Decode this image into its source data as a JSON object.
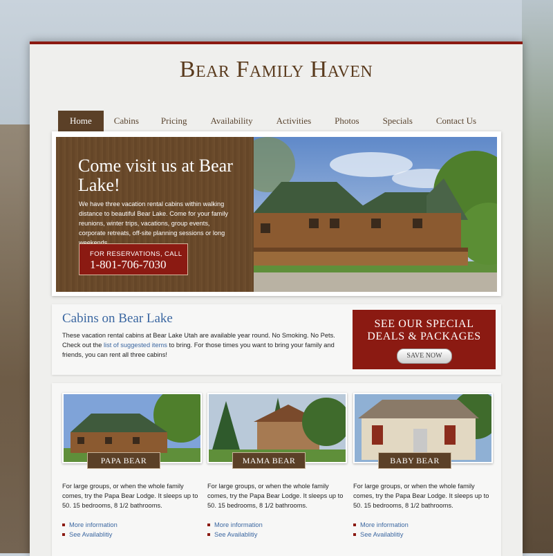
{
  "site": {
    "logo": "Bear Family Haven"
  },
  "nav": {
    "items": [
      "Home",
      "Cabins",
      "Pricing",
      "Availability",
      "Activities",
      "Photos",
      "Specials",
      "Contact Us"
    ],
    "active": "Home"
  },
  "hero": {
    "title": "Come visit us at Bear Lake!",
    "text": "We have three vacation rental cabins within walking distance to beautiful Bear Lake. Come for your family reunions, winter trips, vacations, group events, corporate retreats, off-site planning sessions or long weekends.",
    "cta_line1": "FOR RESERVATIONS, CALL",
    "cta_line2": "1-801-706-7030"
  },
  "cabins_section": {
    "title": "Cabins on Bear Lake",
    "text_before_link": "These vacation rental cabins at Bear Lake Utah are available year round. No Smoking. No Pets. Check out the ",
    "link_text": "list of suggested items",
    "text_after_link": " to bring. For those times you want to bring your family and friends, you can rent all three cabins!",
    "deals_line1": "SEE OUR SPECIAL",
    "deals_line2": "DEALS & PACKAGES",
    "deals_button": "SAVE NOW"
  },
  "cards": [
    {
      "label": "PAPA BEAR",
      "text": "For large groups, or when the whole family comes, try the Papa Bear Lodge. It sleeps up to 50. 15 bedrooms, 8 1/2 bathrooms.",
      "link1": "More information",
      "link2": "See Availablitiy"
    },
    {
      "label": "MAMA BEAR",
      "text": "For large groups, or when the whole family comes, try the Papa Bear Lodge. It sleeps up to 50. 15 bedrooms, 8 1/2 bathrooms.",
      "link1": "More information",
      "link2": "See Availablitiy"
    },
    {
      "label": "BABY BEAR",
      "text": "For large groups, or when the whole family comes, try the Papa Bear Lodge. It sleeps up to 50. 15 bedrooms, 8 1/2 bathrooms.",
      "link1": "More information",
      "link2": "See Availablitiy"
    }
  ],
  "colors": {
    "accent_red": "#8b1a12",
    "brown": "#5b4027",
    "link_blue": "#3b67a1"
  }
}
